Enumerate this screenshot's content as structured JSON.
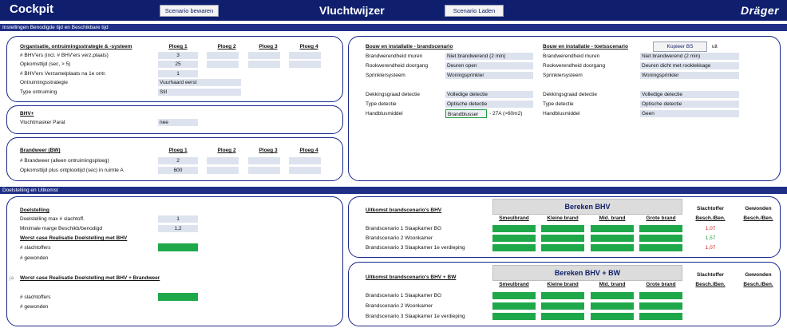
{
  "header": {
    "app_name": "Cockpit",
    "save_scenario": "Scenario bewaren",
    "title": "Vluchtwijzer",
    "load_scenario": "Scenario Laden",
    "brand": "Dräger"
  },
  "section1": {
    "title": "Instellingen Benodigde tijd en Beschikbare tijd"
  },
  "org": {
    "heading": "Organisatie, ontruimingsstrategie & -systeem",
    "ploeg_headers": [
      "Ploeg 1",
      "Ploeg 2",
      "Ploeg 3",
      "Ploeg 4"
    ],
    "rows": [
      {
        "label": "# BHV'ers (incl. # BHV'ers verz.plaats)",
        "value": "3"
      },
      {
        "label": "Opkomsttijd (sec, > 5)",
        "value": "25"
      },
      {
        "label": "# BHV'ers Verzamelplaats na 1e ontr.",
        "value": "1"
      },
      {
        "label": "Ontruimingsstrategie",
        "value": "Vuurhaard eerst"
      },
      {
        "label": "Type ontruiming",
        "value": "Stil"
      }
    ]
  },
  "bhvplus": {
    "heading": "BHV+",
    "label": "Vluchtmasker Parat",
    "value": "nee"
  },
  "brandweer": {
    "heading": "Brandweer (BW)",
    "ploeg_headers": [
      "Ploeg 1",
      "Ploeg 2",
      "Ploeg 3",
      "Ploeg 4"
    ],
    "rows": [
      {
        "label": "# Brandweer (alleen ontruimingsploeg)",
        "value": "2"
      },
      {
        "label": "Opkomsttijd plus ontplooitijd (sec) in ruimte A",
        "value": "600"
      }
    ]
  },
  "bouw_brand": {
    "heading": "Bouw en installatie - brandscenario",
    "rows": [
      {
        "label": "Brandwerendheid muren",
        "value": "Niet brandwerend (2 min)"
      },
      {
        "label": "Rookwerendheid doorgang",
        "value": "Deuren open"
      },
      {
        "label": "Sprinklersysteem",
        "value": "Woningsprinkler"
      },
      {
        "label": "Dekkingsgraad detectie",
        "value": "Volledige detectie"
      },
      {
        "label": "Type detectie",
        "value": "Optische detectie"
      },
      {
        "label": "Handblusmiddel",
        "value": "Brandblusser",
        "extra": "- 27A (>60m2)"
      }
    ]
  },
  "bouw_toets": {
    "heading": "Bouw en installatie - toetsscenario",
    "copy_button": "Kopieer BS",
    "copy_suffix": "uit",
    "rows": [
      {
        "label": "Brandwerendheid muren",
        "value": "Niet brandwerend (2 min)"
      },
      {
        "label": "Rookwerendheid doorgang",
        "value": "Deuren dicht met rooklekkage"
      },
      {
        "label": "Sprinklersysteem",
        "value": "Woningsprinkler"
      },
      {
        "label": "Dekkingsgraad detectie",
        "value": "Volledige detectie"
      },
      {
        "label": "Type detectie",
        "value": "Optische detectie"
      },
      {
        "label": "Handblusmiddel",
        "value": "Geen"
      }
    ]
  },
  "section2": {
    "title": "Doelstelling en Uitkomst"
  },
  "doel": {
    "heading": "Doelstelling",
    "rows": [
      {
        "label": "Doelstelling max # slachtoff.",
        "value": "1"
      },
      {
        "label": "Minimale marge Beschikb/benodigd",
        "value": "1,2"
      }
    ],
    "worst_bhv": "Worst case Realisatie Doelstelling met BHV",
    "worst_bhv_bw": "Worst case Realisatie Doelstelling met BHV + Brandweer",
    "slachtoffers": "# slachtoffers",
    "gewonden": "# gewonden",
    "side_mark": "ja"
  },
  "uitkomst_bhv": {
    "heading": "Uitkomst brandscenario's BHV",
    "button": "Bereken BHV",
    "col_headers": [
      "Smeulbrand",
      "Kleine brand",
      "Mid. brand",
      "Grote brand"
    ],
    "slacht_header": "Slachtoffer",
    "gewond_header": "Gewonden",
    "besch_header": "Besch./Ben.",
    "scenarios": [
      {
        "label": "Brandscenario 1 Slaapkamer BG",
        "ratio": "1,07",
        "status": "red"
      },
      {
        "label": "Brandscenario 2 Woonkamer",
        "ratio": "1,57",
        "status": "green"
      },
      {
        "label": "Brandscenario 3 Slaapkamer 1e verdieping",
        "ratio": "1,07",
        "status": "red"
      }
    ]
  },
  "uitkomst_bw": {
    "heading": "Uitkomst brandscenario's BHV + BW",
    "button": "Bereken BHV + BW",
    "col_headers": [
      "Smeulbrand",
      "Kleine brand",
      "Mid. brand",
      "Grote brand"
    ],
    "slacht_header": "Slachtoffer",
    "gewond_header": "Gewonden",
    "besch_header": "Besch./Ben.",
    "scenarios": [
      {
        "label": "Brandscenario 1 Slaapkamer BG"
      },
      {
        "label": "Brandscenario 2 Woonkamer"
      },
      {
        "label": "Brandscenario 3 Slaapkamer 1e verdieping"
      }
    ]
  },
  "colors": {
    "navy": "#0f1f6e",
    "green": "#1fa84a",
    "cell": "#dde3ee",
    "red": "#d02020"
  }
}
